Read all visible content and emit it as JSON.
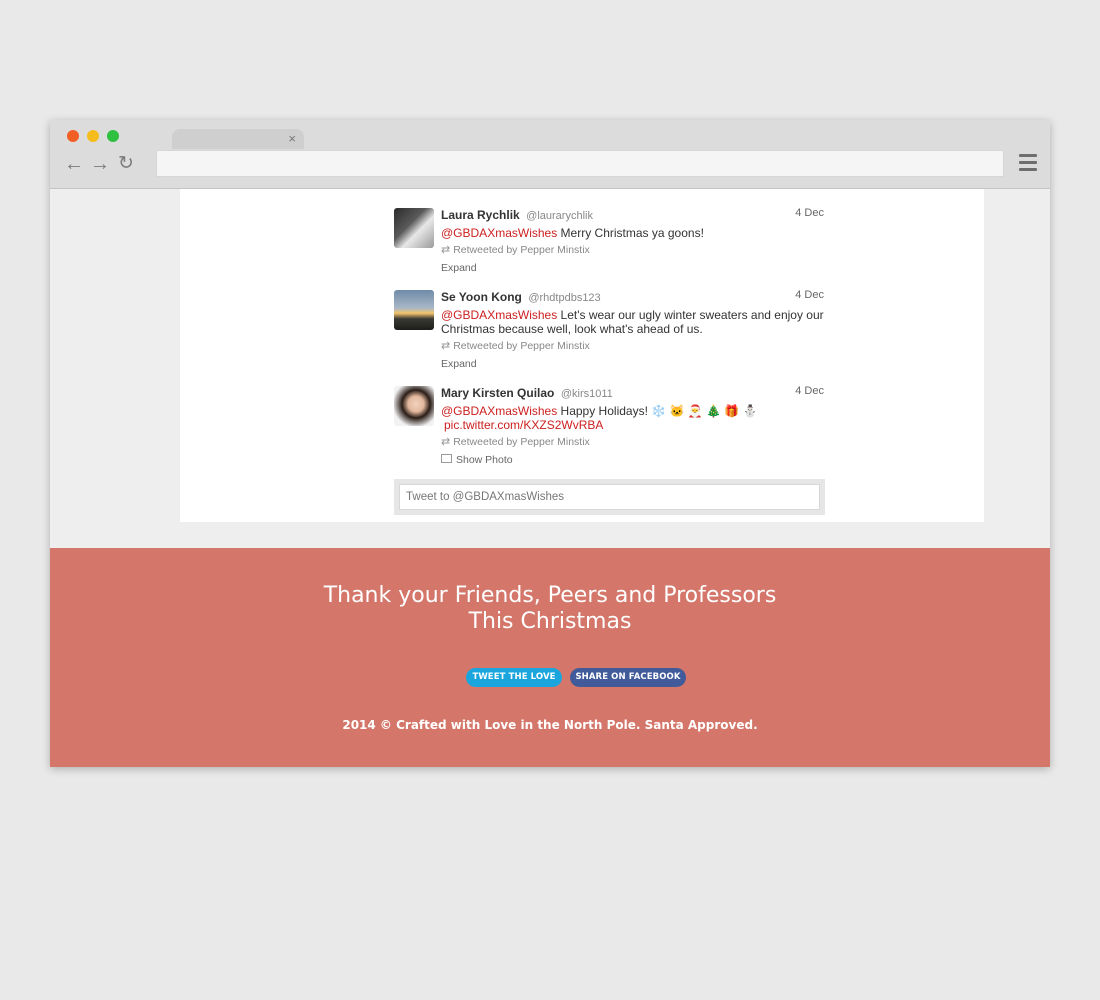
{
  "browser": {
    "tab_close": "×",
    "address": "",
    "nav": {
      "back": "←",
      "forward": "→",
      "reload": "↻"
    }
  },
  "tweets": [
    {
      "name": "Laura Rychlik",
      "handle": "@laurarychlik",
      "date": "4 Dec",
      "mention": "@GBDAXmasWishes",
      "text": " Merry Christmas ya goons!",
      "link": "",
      "retweet": "Retweeted by Pepper Minstix",
      "action": "Expand"
    },
    {
      "name": "Se Yoon Kong",
      "handle": "@rhdtpdbs123",
      "date": "4 Dec",
      "mention": "@GBDAXmasWishes",
      "text": " Let's wear our ugly winter sweaters and enjoy our Christmas because well, look what's ahead of us.",
      "link": "",
      "retweet": "Retweeted by Pepper Minstix",
      "action": "Expand"
    },
    {
      "name": "Mary Kirsten Quilao",
      "handle": "@kirs1011",
      "date": "4 Dec",
      "mention": "@GBDAXmasWishes",
      "text": " Happy Holidays! ❄️ 🐱 🎅 🎄 🎁 ⛄",
      "link": "pic.twitter.com/KXZS2WvRBA",
      "retweet": "Retweeted by Pepper Minstix",
      "action": "Show Photo"
    }
  ],
  "tweet_box": {
    "placeholder": "Tweet to @GBDAXmasWishes"
  },
  "footer": {
    "headline_line1": "Thank your Friends, Peers and Professors",
    "headline_line2": "This Christmas",
    "tweet_button": "TWEET THE LOVE",
    "facebook_button": "SHARE ON FACEBOOK",
    "copyright": "2014 © Crafted with Love in the North Pole. Santa Approved."
  },
  "colors": {
    "footer_bg": "#d4776a",
    "tweet_button": "#1aa6dd",
    "facebook_button": "#405a9a",
    "mention": "#cc1f1f"
  },
  "icons": [
    "close-icon",
    "back-arrow-icon",
    "forward-arrow-icon",
    "reload-icon",
    "menu-icon",
    "retweet-icon",
    "photo-icon"
  ]
}
